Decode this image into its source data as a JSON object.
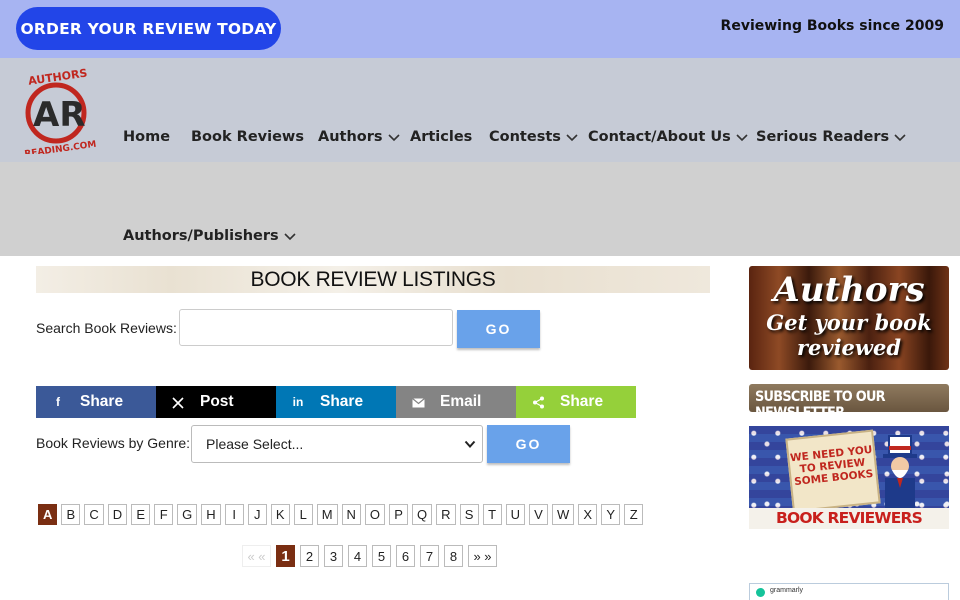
{
  "topbar": {
    "order_label": "ORDER YOUR REVIEW TODAY",
    "tagline": "Reviewing Books since 2009"
  },
  "logo": {
    "icon": "authors-reading-logo",
    "letters": "AR"
  },
  "nav": {
    "items": [
      {
        "label": "Home",
        "has_dropdown": false
      },
      {
        "label": "Book Reviews",
        "has_dropdown": false
      },
      {
        "label": "Authors",
        "has_dropdown": true
      },
      {
        "label": "Articles",
        "has_dropdown": false
      },
      {
        "label": "Contests",
        "has_dropdown": true
      },
      {
        "label": "Contact/About Us",
        "has_dropdown": true
      },
      {
        "label": "Serious Readers",
        "has_dropdown": true
      },
      {
        "label": "Authors/Publishers",
        "has_dropdown": true
      }
    ]
  },
  "main": {
    "heading": "BOOK REVIEW LISTINGS",
    "search": {
      "label": "Search Book Reviews:",
      "value": "",
      "go_label": "GO"
    },
    "share": [
      {
        "label": "Share",
        "icon": "facebook-icon",
        "color": "#3b5998"
      },
      {
        "label": "Post",
        "icon": "x-icon",
        "color": "#000000"
      },
      {
        "label": "Share",
        "icon": "linkedin-icon",
        "color": "#0077b5"
      },
      {
        "label": "Email",
        "icon": "email-icon",
        "color": "#848484"
      },
      {
        "label": "Share",
        "icon": "sharethis-icon",
        "color": "#95d03a"
      }
    ],
    "genre": {
      "label": "Book Reviews by Genre:",
      "selected": "Please Select...",
      "go_label": "GO"
    },
    "alphabet": [
      "A",
      "B",
      "C",
      "D",
      "E",
      "F",
      "G",
      "H",
      "I",
      "J",
      "K",
      "L",
      "M",
      "N",
      "O",
      "P",
      "Q",
      "R",
      "S",
      "T",
      "U",
      "V",
      "W",
      "X",
      "Y",
      "Z"
    ],
    "active_letter": "A",
    "pagination": {
      "prev": "« «",
      "pages": [
        "1",
        "2",
        "3",
        "4",
        "5",
        "6",
        "7",
        "8"
      ],
      "current": "1",
      "next": "» »"
    }
  },
  "sidebar": {
    "authors_ad": {
      "line1": "Authors",
      "line2": "Get your book",
      "line3": "reviewed"
    },
    "newsletter_ad": "SUBSCRIBE TO OUR NEWSLETTER",
    "wanted_ad": {
      "sign": "WE NEED YOU TO REVIEW SOME BOOKS",
      "banner": "BOOK REVIEWERS WANTED"
    },
    "grammarly_ad": "grammarly"
  },
  "colors": {
    "brand_blue": "#2245e8",
    "accent_brown": "#7a2e12",
    "go_blue": "#69a2ea"
  }
}
